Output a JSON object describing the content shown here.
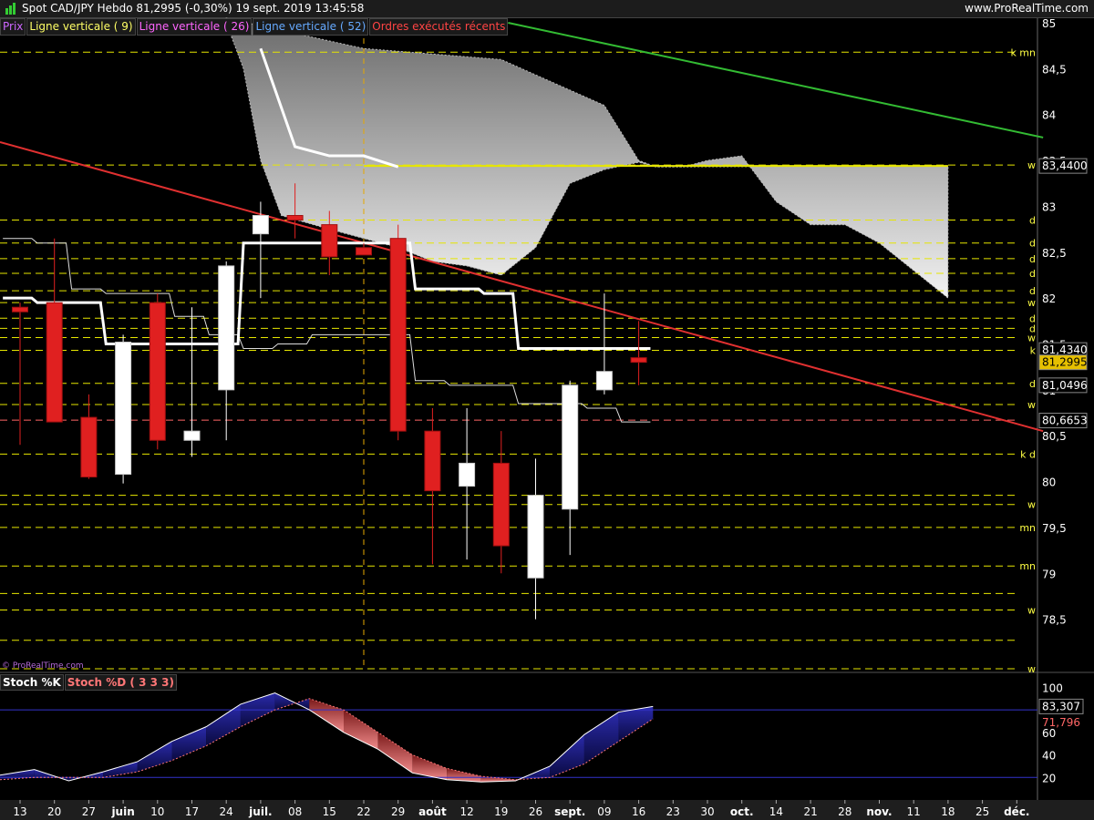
{
  "header": {
    "title": "Spot CAD/JPY   Hebdo   81,2995 (-0,30%)   19 sept. 2019 13:45:58",
    "site": "www.ProRealTime.com"
  },
  "legend": [
    {
      "label": "Prix",
      "color": "#cc66ff"
    },
    {
      "label": "Ligne verticale ( 9)",
      "color": "#ffff66"
    },
    {
      "label": "Ligne verticale ( 26)",
      "color": "#ff66ff"
    },
    {
      "label": "Ligne verticale ( 52)",
      "color": "#66aaff"
    },
    {
      "label": "Ordres exécutés récents",
      "color": "#ff4444"
    }
  ],
  "watermark": "© ProRealTime.com",
  "stoch_legend": [
    {
      "label": "Stoch %K",
      "color": "#ffffff"
    },
    {
      "label": "Stoch %D ( 3 3 3)",
      "color": "#ff7777"
    }
  ],
  "colors": {
    "up": "#ffffff",
    "down": "#e02020",
    "ma": "#ffffff",
    "red_trend": "#e03030",
    "green_trend": "#33bb33",
    "level": "#e6e600"
  },
  "chart_data": [
    {
      "type": "candlestick",
      "title": "Spot CAD/JPY Hebdo",
      "x_ticks": [
        "13",
        "20",
        "27",
        "juin",
        "10",
        "17",
        "24",
        "juil.",
        "08",
        "15",
        "22",
        "29",
        "août",
        "12",
        "19",
        "26",
        "sept.",
        "09",
        "16",
        "23",
        "30",
        "oct.",
        "14",
        "21",
        "28",
        "nov.",
        "11",
        "18",
        "25",
        "déc."
      ],
      "y_ticks": [
        "78,5",
        "79",
        "79,5",
        "80",
        "80,5",
        "81",
        "81,5",
        "82",
        "82,5",
        "83",
        "83,5",
        "84",
        "84,5",
        "85"
      ],
      "ylim": [
        77.95,
        85.05
      ],
      "candles": [
        {
          "o": 81.9,
          "h": 81.95,
          "l": 80.4,
          "c": 81.85
        },
        {
          "o": 81.95,
          "h": 82.65,
          "l": 80.8,
          "c": 80.65
        },
        {
          "o": 80.7,
          "h": 80.95,
          "l": 80.03,
          "c": 80.05
        },
        {
          "o": 80.08,
          "h": 81.6,
          "l": 79.98,
          "c": 81.52
        },
        {
          "o": 81.95,
          "h": 82.05,
          "l": 80.35,
          "c": 80.45
        },
        {
          "o": 80.45,
          "h": 81.9,
          "l": 80.27,
          "c": 80.55
        },
        {
          "o": 81.0,
          "h": 82.4,
          "l": 80.45,
          "c": 82.35
        },
        {
          "o": 82.7,
          "h": 83.05,
          "l": 82.0,
          "c": 82.9
        },
        {
          "o": 82.9,
          "h": 83.25,
          "l": 82.65,
          "c": 82.85
        },
        {
          "o": 82.8,
          "h": 82.95,
          "l": 82.25,
          "c": 82.45
        },
        {
          "o": 82.55,
          "h": 82.6,
          "l": 82.5,
          "c": 82.47
        },
        {
          "o": 82.65,
          "h": 82.8,
          "l": 80.45,
          "c": 80.55
        },
        {
          "o": 80.55,
          "h": 80.8,
          "l": 79.1,
          "c": 79.9
        },
        {
          "o": 79.95,
          "h": 80.8,
          "l": 79.15,
          "c": 80.2
        },
        {
          "o": 80.2,
          "h": 80.55,
          "l": 79.0,
          "c": 79.3
        },
        {
          "o": 78.95,
          "h": 80.25,
          "l": 78.5,
          "c": 79.85
        },
        {
          "o": 79.7,
          "h": 81.1,
          "l": 79.2,
          "c": 81.05
        },
        {
          "o": 81.0,
          "h": 82.05,
          "l": 80.95,
          "c": 81.2
        },
        {
          "o": 81.35,
          "h": 81.75,
          "l": 81.05,
          "c": 81.3
        }
      ],
      "ma_thick": [
        82.0,
        81.95,
        81.95,
        81.5,
        81.5,
        81.5,
        81.5,
        82.6,
        82.6,
        82.6,
        82.6,
        82.6,
        82.1,
        82.1,
        82.05,
        81.45,
        81.45,
        81.45,
        81.45
      ],
      "ma_thin": [
        82.65,
        82.6,
        82.1,
        82.05,
        82.05,
        81.8,
        81.6,
        81.45,
        81.5,
        81.6,
        81.6,
        81.6,
        81.1,
        81.05,
        81.05,
        80.85,
        80.85,
        80.8,
        80.65
      ],
      "cloud_top": [
        [
          10,
          84.72
        ],
        [
          14,
          84.6
        ],
        [
          17,
          84.1
        ],
        [
          18,
          83.5
        ],
        [
          18.5,
          83.43
        ],
        [
          19.3,
          83.43
        ],
        [
          20,
          83.5
        ],
        [
          21,
          83.55
        ],
        [
          22,
          83.05
        ],
        [
          23,
          82.8
        ],
        [
          24,
          82.8
        ],
        [
          25,
          82.6
        ],
        [
          26,
          82.3
        ],
        [
          27,
          82.0
        ]
      ],
      "cloud_bottom": [
        [
          6,
          85.0
        ],
        [
          6.5,
          84.5
        ],
        [
          7,
          83.5
        ],
        [
          7.6,
          82.9
        ],
        [
          9,
          82.75
        ],
        [
          11,
          82.55
        ],
        [
          12,
          82.4
        ],
        [
          13,
          82.35
        ],
        [
          14,
          82.25
        ],
        [
          15,
          82.55
        ],
        [
          16,
          83.25
        ],
        [
          17,
          83.4
        ],
        [
          18,
          83.48
        ],
        [
          18.5,
          83.43
        ],
        [
          19,
          83.43
        ]
      ],
      "cloud_flat": 83.44,
      "thick_line_upper": [
        [
          7,
          84.72
        ],
        [
          8,
          83.65
        ],
        [
          9,
          83.55
        ],
        [
          10,
          83.55
        ],
        [
          11,
          83.43
        ]
      ],
      "red_trendline": [
        [
          0,
          83.7
        ],
        [
          29.5,
          80.55
        ]
      ],
      "green_trendline": [
        [
          14.2,
          85.0
        ],
        [
          29.5,
          83.75
        ]
      ],
      "levels": [
        {
          "y": 84.68,
          "tag": "k mn"
        },
        {
          "y": 83.45,
          "tag": "w"
        },
        {
          "y": 82.85,
          "tag": "d"
        },
        {
          "y": 82.6,
          "tag": "d"
        },
        {
          "y": 82.43,
          "tag": "d"
        },
        {
          "y": 82.27,
          "tag": "d"
        },
        {
          "y": 82.08,
          "tag": "d"
        },
        {
          "y": 81.95,
          "tag": "w"
        },
        {
          "y": 81.78,
          "tag": "d"
        },
        {
          "y": 81.67,
          "tag": "d"
        },
        {
          "y": 81.57,
          "tag": "w"
        },
        {
          "y": 81.43,
          "tag": "k"
        },
        {
          "y": 81.07,
          "tag": "d"
        },
        {
          "y": 80.84,
          "tag": "w"
        },
        {
          "y": 80.67,
          "tag": ""
        },
        {
          "y": 80.3,
          "tag": "k d"
        },
        {
          "y": 79.85,
          "tag": ""
        },
        {
          "y": 79.75,
          "tag": "w"
        },
        {
          "y": 79.5,
          "tag": "mn"
        },
        {
          "y": 79.08,
          "tag": "mn"
        },
        {
          "y": 78.78,
          "tag": ""
        },
        {
          "y": 78.6,
          "tag": "w"
        },
        {
          "y": 78.27,
          "tag": ""
        },
        {
          "y": 77.96,
          "tag": "w"
        }
      ],
      "price_labels": [
        {
          "y": 83.44,
          "text": "83,4400"
        },
        {
          "y": 81.434,
          "text": "81,4340"
        },
        {
          "y": 81.2995,
          "text": "81,2995",
          "current": true
        },
        {
          "y": 81.0496,
          "text": "81,0496"
        },
        {
          "y": 80.6653,
          "text": "80,6653"
        }
      ],
      "vertical_marker_index": 10
    },
    {
      "type": "line",
      "title": "Stoch %K / Stoch %D ( 3 3 3)",
      "y_ticks": [
        "20",
        "40",
        "60",
        "100"
      ],
      "ylim": [
        0,
        110
      ],
      "levels": [
        20,
        80
      ],
      "k": [
        22,
        27,
        17,
        25,
        34,
        52,
        65,
        85,
        95,
        80,
        60,
        45,
        24,
        18,
        16,
        17,
        30,
        58,
        78,
        83
      ],
      "d": [
        18,
        20,
        20,
        20,
        25,
        35,
        48,
        65,
        80,
        90,
        80,
        60,
        40,
        28,
        21,
        18,
        20,
        32,
        52,
        72
      ],
      "k_last": "83,307",
      "d_last": "71,796"
    }
  ]
}
